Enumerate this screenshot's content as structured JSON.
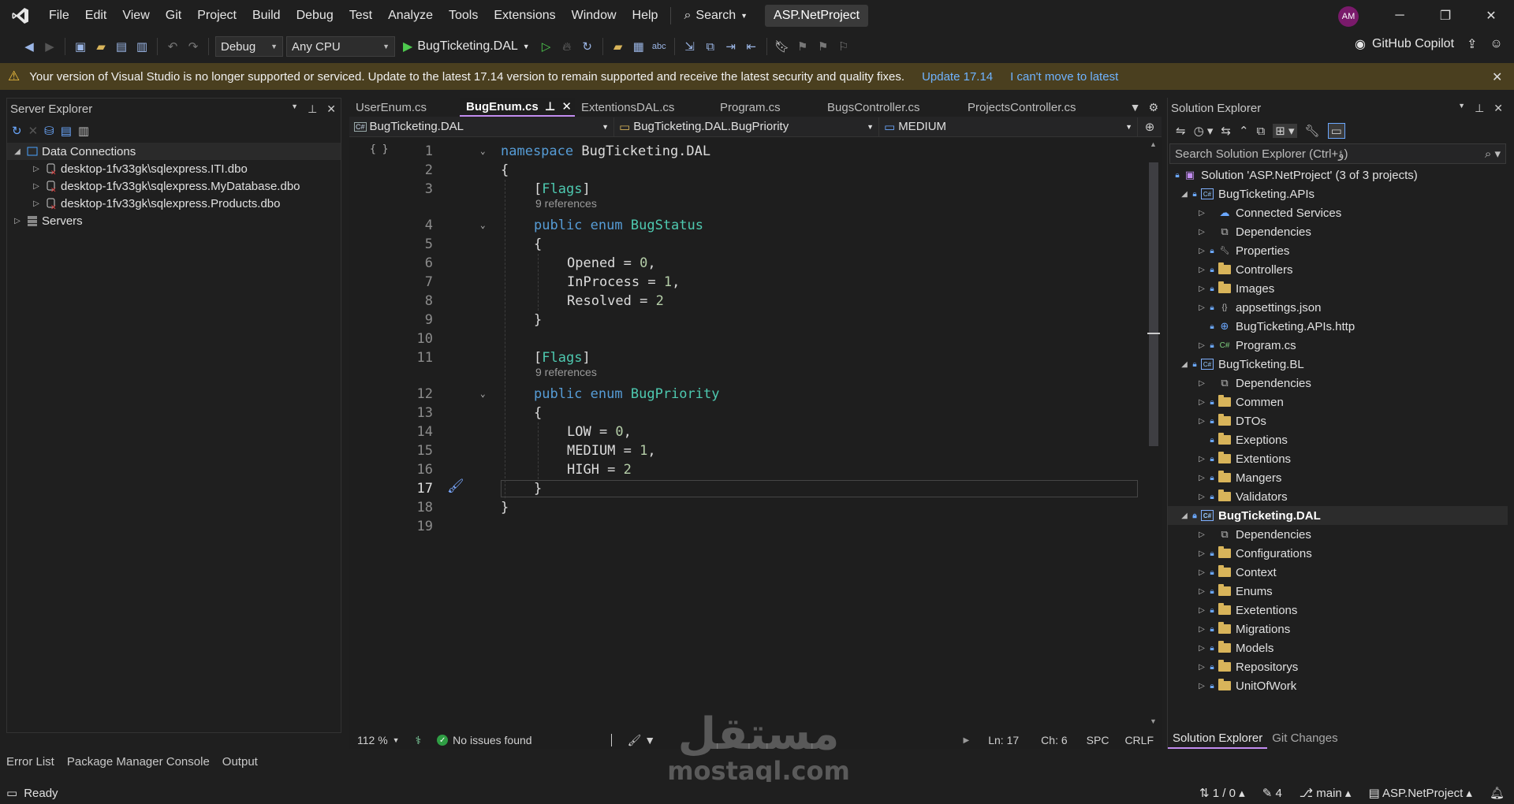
{
  "menu": {
    "items": [
      "File",
      "Edit",
      "View",
      "Git",
      "Project",
      "Build",
      "Debug",
      "Test",
      "Analyze",
      "Tools",
      "Extensions",
      "Window",
      "Help"
    ],
    "search_label": "Search",
    "solution_name": "ASP.NetProject",
    "avatar_initials": "AM"
  },
  "toolbar": {
    "config": "Debug",
    "platform": "Any CPU",
    "run_target": "BugTicketing.DAL",
    "copilot_label": "GitHub Copilot"
  },
  "infobar": {
    "message": "Your version of Visual Studio is no longer supported or serviced. Update to the latest 17.14 version to remain supported and receive the latest security and quality fixes.",
    "update_link": "Update 17.14",
    "decline_link": "I can't move to latest"
  },
  "server_explorer": {
    "title": "Server Explorer",
    "root": "Data Connections",
    "connections": [
      "desktop-1fv33gk\\sqlexpress.ITI.dbo",
      "desktop-1fv33gk\\sqlexpress.MyDatabase.dbo",
      "desktop-1fv33gk\\sqlexpress.Products.dbo"
    ],
    "servers": "Servers"
  },
  "editor": {
    "tabs": [
      {
        "label": "UserEnum.cs",
        "active": false
      },
      {
        "label": "BugEnum.cs",
        "active": true
      },
      {
        "label": "ExtentionsDAL.cs",
        "active": false
      },
      {
        "label": "Program.cs",
        "active": false
      },
      {
        "label": "BugsController.cs",
        "active": false
      },
      {
        "label": "ProjectsController.cs",
        "active": false
      }
    ],
    "nav_project": "BugTicketing.DAL",
    "nav_type": "BugTicketing.DAL.BugPriority",
    "nav_member": "MEDIUM",
    "references_label": "9 references",
    "lines": [
      {
        "n": "1",
        "text": "namespace BugTicketing.DAL"
      },
      {
        "n": "2",
        "text": "{"
      },
      {
        "n": "3",
        "text": "[Flags]"
      },
      {
        "n": "4",
        "text": "public enum BugStatus"
      },
      {
        "n": "5",
        "text": "{"
      },
      {
        "n": "6",
        "text": "Opened = 0,"
      },
      {
        "n": "7",
        "text": "InProcess = 1,"
      },
      {
        "n": "8",
        "text": "Resolved = 2"
      },
      {
        "n": "9",
        "text": "}"
      },
      {
        "n": "10",
        "text": ""
      },
      {
        "n": "11",
        "text": "[Flags]"
      },
      {
        "n": "12",
        "text": "public enum BugPriority"
      },
      {
        "n": "13",
        "text": "{"
      },
      {
        "n": "14",
        "text": "LOW = 0,"
      },
      {
        "n": "15",
        "text": "MEDIUM = 1,"
      },
      {
        "n": "16",
        "text": "HIGH = 2"
      },
      {
        "n": "17",
        "text": "}"
      },
      {
        "n": "18",
        "text": "}"
      },
      {
        "n": "19",
        "text": ""
      }
    ],
    "status": {
      "zoom": "112 %",
      "issues": "No issues found",
      "line": "Ln: 17",
      "col": "Ch: 6",
      "whitespace": "SPC",
      "line_endings": "CRLF"
    }
  },
  "solution_explorer": {
    "title": "Solution Explorer",
    "search_placeholder": "Search Solution Explorer (Ctrl+ؤ)",
    "solution_label": "Solution 'ASP.NetProject' (3 of 3 projects)",
    "projects": [
      {
        "name": "BugTicketing.APIs",
        "items": [
          "Connected Services",
          "Dependencies",
          "Properties",
          "Controllers",
          "Images",
          "appsettings.json",
          "BugTicketing.APIs.http",
          "Program.cs"
        ]
      },
      {
        "name": "BugTicketing.BL",
        "items": [
          "Dependencies",
          "Commen",
          "DTOs",
          "Exeptions",
          "Extentions",
          "Mangers",
          "Validators"
        ]
      },
      {
        "name": "BugTicketing.DAL",
        "items": [
          "Dependencies",
          "Configurations",
          "Context",
          "Enums",
          "Exetentions",
          "Migrations",
          "Models",
          "Repositorys",
          "UnitOfWork"
        ]
      }
    ],
    "bottom_tabs": [
      "Solution Explorer",
      "Git Changes"
    ]
  },
  "bottom_tabs": [
    "Error List",
    "Package Manager Console",
    "Output"
  ],
  "statusbar": {
    "ready": "Ready",
    "sync": "1 / 0",
    "pending": "4",
    "branch": "main",
    "repo": "ASP.NetProject"
  },
  "watermark": {
    "arabic": "مستقل",
    "latin": "mostaql.com"
  },
  "colors": {
    "accent": "#c28cf0",
    "infobar_bg": "#4a3f1f",
    "link": "#6fb3ff"
  }
}
